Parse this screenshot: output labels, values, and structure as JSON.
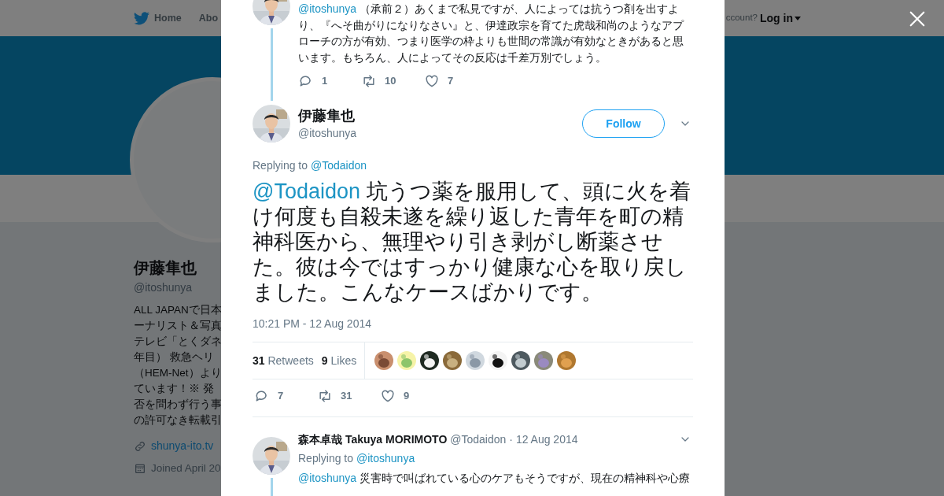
{
  "background_page": {
    "nav": [
      {
        "label": "Home"
      },
      {
        "label": "Abo"
      }
    ],
    "login_prompt": "ccount?",
    "login": "Log in",
    "profile": {
      "name": "伊藤隼也",
      "handle": "@itoshunya",
      "bio_lines": [
        "ALL JAPANで日本",
        "ーナリスト＆写真",
        "テレビ「とくダネ",
        "年目） 救急ヘリ",
        "（HEM-Net）より",
        "ています！※ 発",
        "否を問わず行う事",
        "の許可なき転載引"
      ],
      "website": "shunya-ito.tv",
      "joined": "Joined April 20"
    }
  },
  "modal": {
    "conversation_above": {
      "mention": "@itoshunya",
      "text": "（承前２）あくまで私見ですが、人によっては抗うつ剤を出すより、『へそ曲がりになりなさい』と、伊達政宗を育てた虎哉和尚のようなアプローチの方が有効、つまり医学の枠よりも世間の常識が有効なときがあると思います。もちろん、人によってその反応は千差万別でしょう。",
      "replies": "1",
      "retweets": "10",
      "likes": "7"
    },
    "focused_tweet": {
      "name": "伊藤隼也",
      "handle": "@itoshunya",
      "follow": "Follow",
      "replying_label": "Replying to",
      "replying_to": "@Todaidon",
      "mention": "@Todaidon",
      "text": "坑うつ薬を服用して、頭に火を着け何度も自殺未遂を繰り返した青年を町の精神科医から、無理やり引き剥がし断薬させた。彼は今ではすっかり健康な心を取り戻しました。こんなケースばかりです。",
      "time": "10:21 PM - 12 Aug 2014",
      "retweet_count": "31",
      "retweet_label": "Retweets",
      "like_count": "9",
      "like_label": "Likes",
      "replies": "7",
      "retweets": "31",
      "likes": "9"
    },
    "replies": [
      {
        "name": "森本卓哉 Takuya MORIMOTO",
        "handle": "@Todaidon",
        "date": "· 12 Aug 2014",
        "replying_label": "Replying to",
        "replying_to": "@itoshunya",
        "mention": "@itoshunya",
        "text": "災害時で叫ばれている心のケアもそうですが、現在の精神科や心療"
      }
    ]
  }
}
